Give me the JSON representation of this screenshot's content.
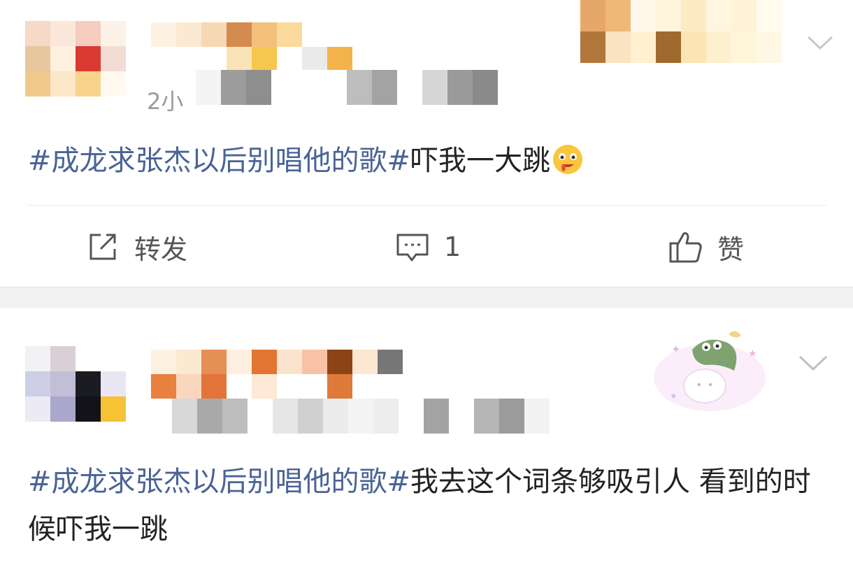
{
  "posts": [
    {
      "meta_visible": "2小",
      "content_topic": "#成龙求张杰以后别唱他的歌#",
      "content_text": "吓我一大跳",
      "emoji": "drooling-face-emoji",
      "actions": {
        "repost_label": "转发",
        "comment_count": "1",
        "like_label": "赞"
      }
    },
    {
      "meta_visible": "",
      "content_topic": "#成龙求张杰以后别唱他的歌#",
      "content_text": "我去这个词条够吸引人 看到的时候吓我一跳"
    }
  ],
  "icons": {
    "repost": "share-edit-icon",
    "comment": "comment-bubble-icon",
    "like": "thumbs-up-icon",
    "more": "chevron-down-icon"
  },
  "colors": {
    "topic_link": "#4a6396",
    "body_text": "#222222",
    "meta_text": "#9a9a9a",
    "separator": "#f2f2f2"
  }
}
